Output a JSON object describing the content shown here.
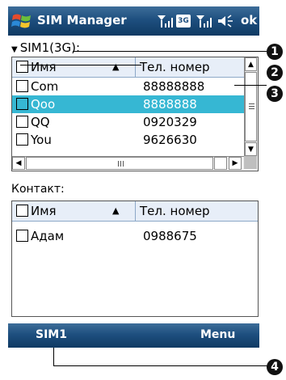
{
  "titlebar": {
    "app_title": "SIM Manager",
    "ok_label": "ok",
    "icons": [
      "windows-flag-icon",
      "signal-icon",
      "3g-icon",
      "signal-strength-icon",
      "volume-icon"
    ],
    "badge_3g": "3G"
  },
  "sim_section": {
    "label": "SIM1(3G):",
    "columns": {
      "name": "Имя",
      "phone": "Тел. номер"
    },
    "rows": [
      {
        "name": "Com",
        "phone": "88888888",
        "selected": false
      },
      {
        "name": "Qoo",
        "phone": "8888888",
        "selected": true
      },
      {
        "name": "QQ",
        "phone": "0920329",
        "selected": false
      },
      {
        "name": "You",
        "phone": "9626630",
        "selected": false
      }
    ]
  },
  "contacts_section": {
    "label": "Контакт:",
    "columns": {
      "name": "Имя",
      "phone": "Тел. номер"
    },
    "rows": [
      {
        "name": "Адам",
        "phone": "0988675"
      }
    ]
  },
  "softkeys": {
    "left": "SIM1",
    "right": "Menu"
  },
  "callouts": [
    "1",
    "2",
    "3",
    "4"
  ],
  "colors": {
    "title_bar": "#1e4f7f",
    "selection": "#36b7d3",
    "header_bg": "#e7eef8"
  }
}
